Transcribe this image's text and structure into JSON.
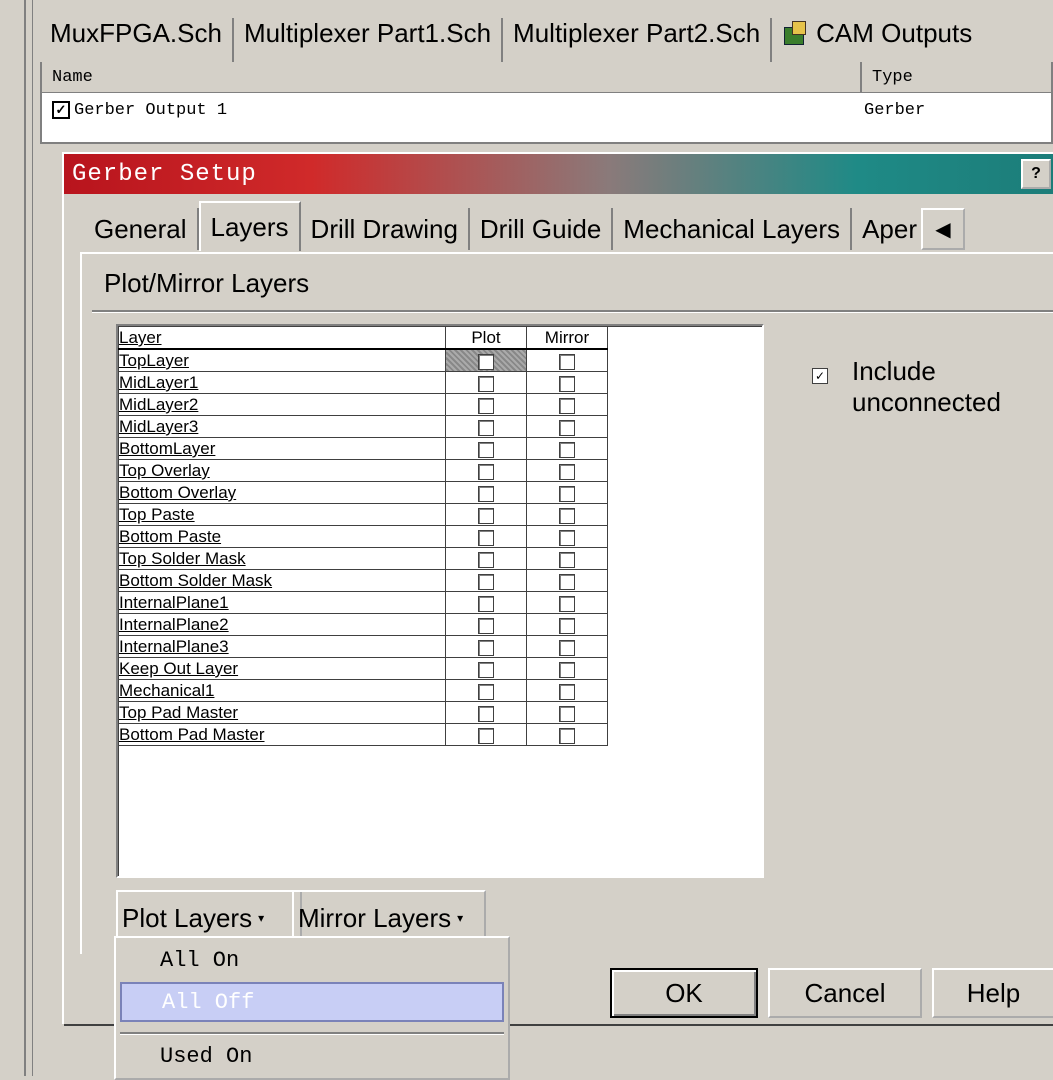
{
  "doc_tabs": [
    "MuxFPGA.Sch",
    "Multiplexer Part1.Sch",
    "Multiplexer Part2.Sch",
    "CAM Outputs"
  ],
  "list": {
    "col_name": "Name",
    "col_type": "Type",
    "row": {
      "name": "Gerber Output 1",
      "type": "Gerber",
      "checked": true
    }
  },
  "dialog": {
    "title": "Gerber Setup",
    "help_glyph": "?",
    "tabs": [
      "General",
      "Layers",
      "Drill Drawing",
      "Drill Guide",
      "Mechanical Layers",
      "Aper"
    ],
    "active_tab": "Layers",
    "section_title": "Plot/Mirror Layers",
    "grid": {
      "headers": {
        "layer": "Layer",
        "plot": "Plot",
        "mirror": "Mirror"
      },
      "layers": [
        "TopLayer",
        "MidLayer1",
        "MidLayer2",
        "MidLayer3",
        "BottomLayer",
        "Top Overlay",
        "Bottom Overlay",
        "Top Paste",
        "Bottom Paste",
        "Top Solder Mask",
        "Bottom Solder Mask",
        "InternalPlane1",
        "InternalPlane2",
        "InternalPlane3",
        "Keep Out Layer",
        "Mechanical1",
        "Top Pad Master",
        "Bottom Pad Master"
      ]
    },
    "include_label_1": "Include",
    "include_label_2": "unconnected",
    "include_checked": true,
    "plot_layers_btn": "Plot Layers",
    "mirror_layers_btn": "Mirror Layers",
    "ok": "OK",
    "cancel": "Cancel",
    "help": "Help"
  },
  "menu": {
    "items": [
      "All On",
      "All Off",
      "Used On"
    ],
    "highlighted": "All Off"
  }
}
